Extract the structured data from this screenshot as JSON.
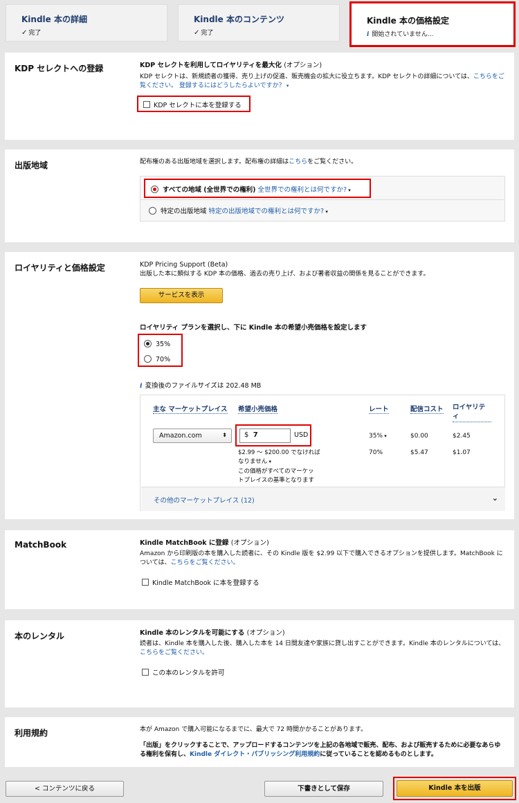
{
  "tabs": [
    {
      "title": "Kindle 本の詳細",
      "status": "完了"
    },
    {
      "title": "Kindle 本のコンテンツ",
      "status": "完了"
    },
    {
      "title": "Kindle 本の価格設定",
      "status": "開始されていません..."
    }
  ],
  "kdp_select": {
    "title": "KDP セレクトへの登録",
    "heading": "KDP セレクトを利用してロイヤリティを最大化",
    "heading_opt": "(オプション)",
    "desc": "KDP セレクトは、新規読者の獲得、売り上げの促進、販売機会の拡大に役立ちます。KDP セレクトの詳細については、",
    "link1": "こちらをご覧ください。",
    "link2": "登録するにはどうしたらよいですか？",
    "checkbox": "KDP セレクトに本を登録する"
  },
  "territories": {
    "title": "出版地域",
    "desc_pre": "配布権のある出版地域を選択します。配布権の詳細は",
    "desc_link": "こちら",
    "desc_post": "をご覧ください。",
    "option1_label": "すべての地域 (全世界での権利)",
    "option1_link": "全世界での権利とは何ですか?",
    "option2_label": "特定の出版地域",
    "option2_link": "特定の出版地域での権利とは何ですか?"
  },
  "royalty": {
    "title": "ロイヤリティと価格設定",
    "support_title": "KDP Pricing Support (Beta)",
    "support_desc": "出版した本に類似する KDP 本の価格、過去の売り上げ、および著者収益の関係を見ることができます。",
    "support_button": "サービスを表示",
    "plan_heading": "ロイヤリティ プランを選択し、下に Kindle 本の希望小売価格を設定します",
    "plan_35": "35%",
    "plan_70": "70%",
    "filesize": "変換後のファイルサイズは 202.48 MB",
    "col_market": "主な マーケットプレイス",
    "col_price": "希望小売価格",
    "col_rate": "レート",
    "col_delivery": "配信コスト",
    "col_royalty": "ロイヤリティ",
    "marketplace": "Amazon.com",
    "currency_symbol": "$",
    "price_value": "7",
    "currency": "USD",
    "price_note1": "$2.99 ～ $200.00 でなければなりません",
    "price_note2": "この価格がすべてのマーケットプレイスの基準となります",
    "row1": {
      "rate": "35%",
      "delivery": "$0.00",
      "royalty": "$2.45"
    },
    "row2": {
      "rate": "70%",
      "delivery": "$5.47",
      "royalty": "$1.07"
    },
    "other_markets": "その他のマーケットプレイス (12)"
  },
  "matchbook": {
    "title": "MatchBook",
    "heading": "Kindle MatchBook に登録",
    "heading_opt": "(オプション)",
    "desc": "Amazon から印刷版の本を購入した読者に、その Kindle 版を $2.99 以下で購入できるオプションを提供します。MatchBook については、",
    "link": "こちらをご覧ください。",
    "checkbox": "Kindle MatchBook に本を登録する"
  },
  "lending": {
    "title": "本のレンタル",
    "heading": "Kindle 本のレンタルを可能にする",
    "heading_opt": "(オプション)",
    "desc": "読者は、Kindle 本を購入した後、購入した本を 14 日間友達や家族に貸し出すことができます。Kindle 本のレンタルについては、",
    "link": "こちらをご覧ください。",
    "checkbox": "この本のレンタルを許可"
  },
  "terms": {
    "title": "利用規約",
    "line1": "本が Amazon で購入可能になるまでに、最大で 72 時間かかることがあります。",
    "line2_pre": "「出版」をクリックすることで、アップロードするコンテンツを上記の各地域で販売、配布、および販売するために必要なあらゆる権利を保有し、",
    "line2_link": "Kindle ダイレクト・パブリッシング利用規約",
    "line2_post": "に従っていることを認めるものとします。"
  },
  "footer": {
    "back": "< コンテンツに戻る",
    "draft": "下書きとして保存",
    "publish": "Kindle 本を出版"
  }
}
